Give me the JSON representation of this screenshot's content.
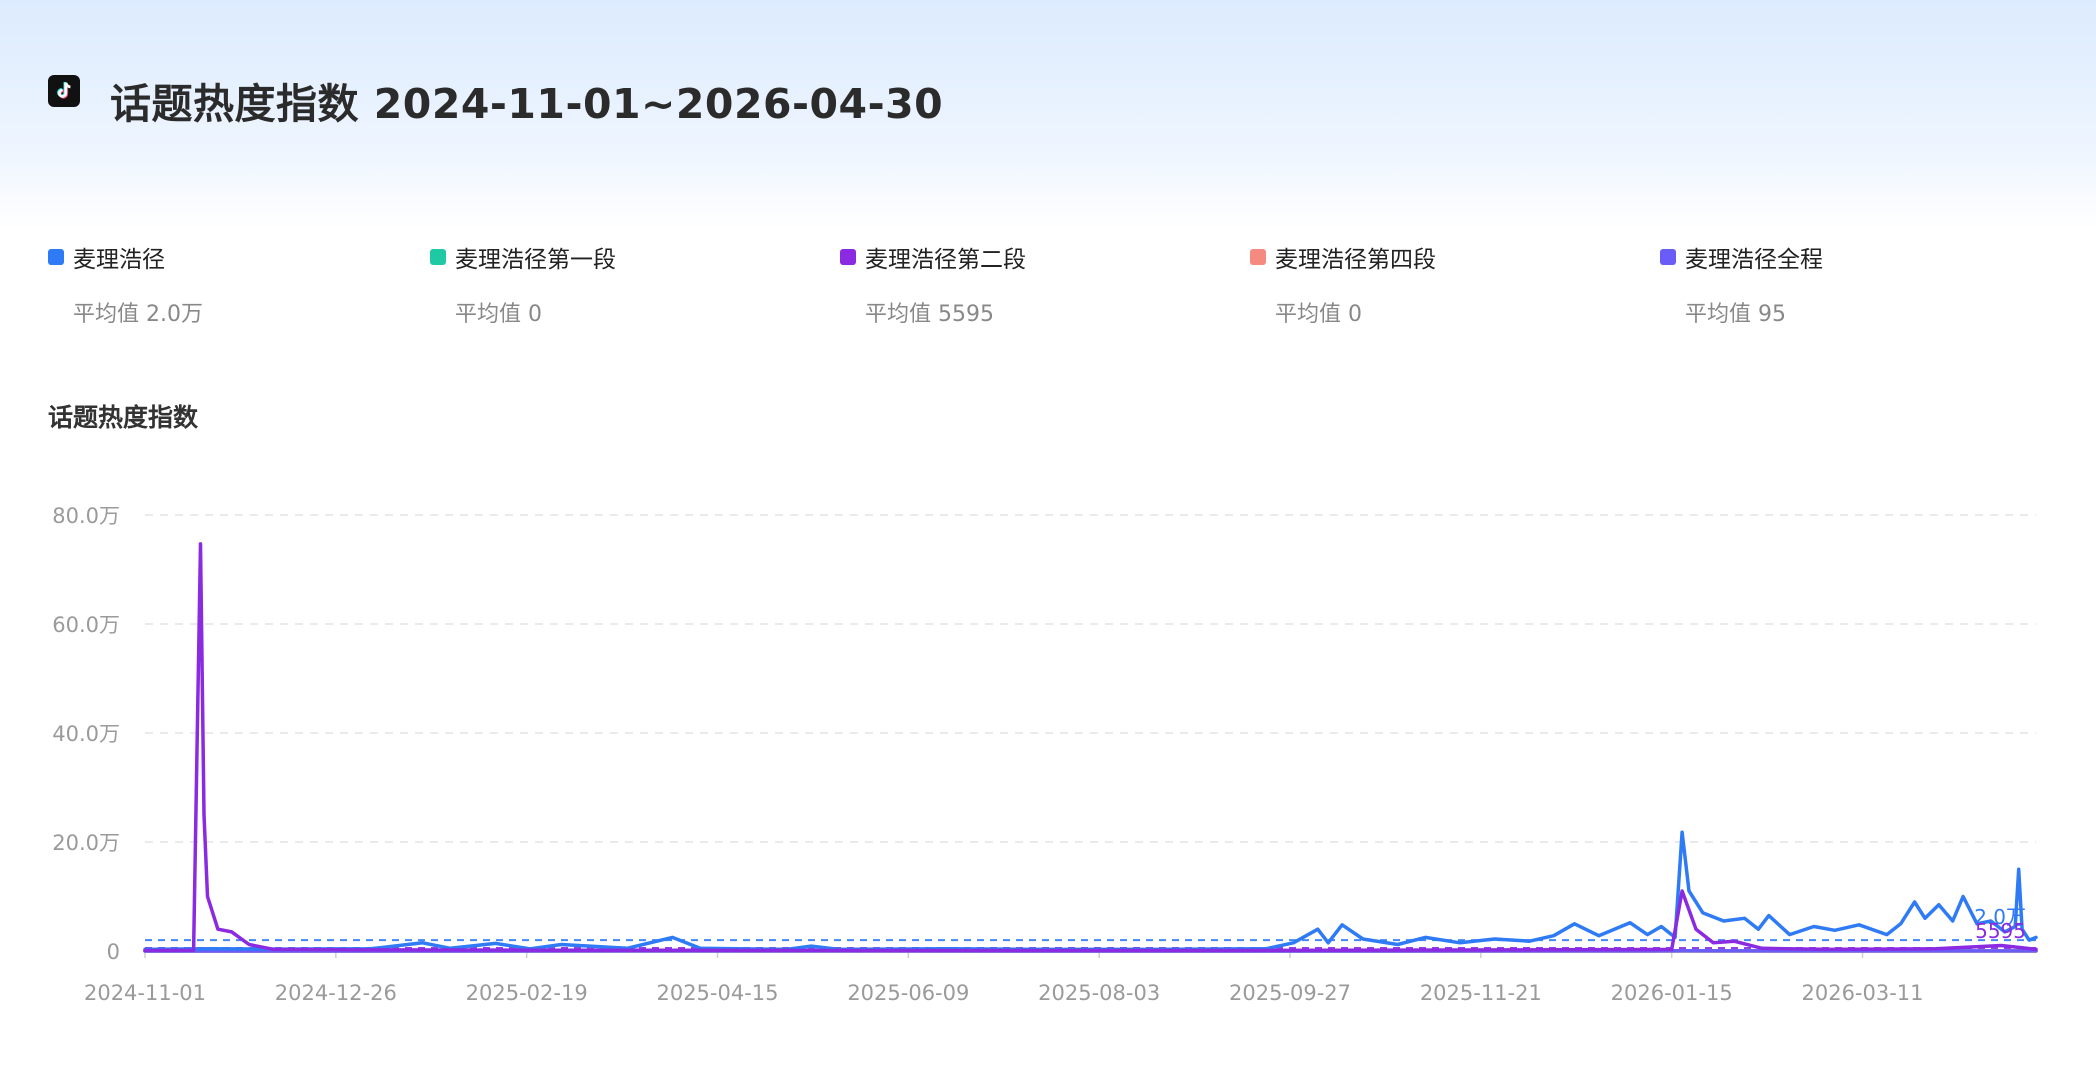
{
  "header": {
    "title": "话题热度指数 2024-11-01~2026-04-30",
    "logo_icon": "tiktok-logo-icon"
  },
  "legend": [
    {
      "name": "麦理浩径",
      "avg_label": "平均值 2.0万",
      "color": "#2f7bf5"
    },
    {
      "name": "麦理浩径第一段",
      "avg_label": "平均值 0",
      "color": "#1fc9a3"
    },
    {
      "name": "麦理浩径第二段",
      "avg_label": "平均值 5595",
      "color": "#8a2be2"
    },
    {
      "name": "麦理浩径第四段",
      "avg_label": "平均值 0",
      "color": "#f48a80"
    },
    {
      "name": "麦理浩径全程",
      "avg_label": "平均值 95",
      "color": "#6a5cf6"
    }
  ],
  "chart_title": "话题热度指数",
  "chart_data": {
    "type": "line",
    "ylim": [
      0,
      800000
    ],
    "y_ticks": [
      0,
      200000,
      400000,
      600000,
      800000
    ],
    "y_tick_labels": [
      "0",
      "20.0万",
      "40.0万",
      "60.0万",
      "80.0万"
    ],
    "x_tick_labels": [
      "2024-11-01",
      "2024-12-26",
      "2025-02-19",
      "2025-04-15",
      "2025-06-09",
      "2025-08-03",
      "2025-09-27",
      "2025-11-21",
      "2026-01-15",
      "2026-03-11"
    ],
    "x_range": [
      "2024-11-01",
      "2026-04-30"
    ],
    "grid": true,
    "avg_line_labels": [
      "2.0万",
      "5595"
    ],
    "series": [
      {
        "name": "麦理浩径",
        "color": "#2f7bf5",
        "average": 20000,
        "points": [
          [
            "2024-11-01",
            3000
          ],
          [
            "2024-11-20",
            4000
          ],
          [
            "2024-12-10",
            3500
          ],
          [
            "2025-01-05",
            4000
          ],
          [
            "2025-01-20",
            15000
          ],
          [
            "2025-01-28",
            5000
          ],
          [
            "2025-02-10",
            14000
          ],
          [
            "2025-02-20",
            4000
          ],
          [
            "2025-03-01",
            12000
          ],
          [
            "2025-03-20",
            5000
          ],
          [
            "2025-04-02",
            25000
          ],
          [
            "2025-04-10",
            5000
          ],
          [
            "2025-05-05",
            3000
          ],
          [
            "2025-05-12",
            9000
          ],
          [
            "2025-05-20",
            3000
          ],
          [
            "2025-06-20",
            4000
          ],
          [
            "2025-07-20",
            3000
          ],
          [
            "2025-08-20",
            3000
          ],
          [
            "2025-09-20",
            4000
          ],
          [
            "2025-09-28",
            15000
          ],
          [
            "2025-10-05",
            40000
          ],
          [
            "2025-10-08",
            15000
          ],
          [
            "2025-10-12",
            48000
          ],
          [
            "2025-10-18",
            22000
          ],
          [
            "2025-10-28",
            12000
          ],
          [
            "2025-11-05",
            25000
          ],
          [
            "2025-11-15",
            15000
          ],
          [
            "2025-11-25",
            22000
          ],
          [
            "2025-12-05",
            18000
          ],
          [
            "2025-12-12",
            28000
          ],
          [
            "2025-12-18",
            50000
          ],
          [
            "2025-12-25",
            28000
          ],
          [
            "2026-01-03",
            52000
          ],
          [
            "2026-01-08",
            30000
          ],
          [
            "2026-01-12",
            45000
          ],
          [
            "2026-01-16",
            25000
          ],
          [
            "2026-01-18",
            218000
          ],
          [
            "2026-01-20",
            110000
          ],
          [
            "2026-01-24",
            70000
          ],
          [
            "2026-01-30",
            55000
          ],
          [
            "2026-02-05",
            60000
          ],
          [
            "2026-02-09",
            40000
          ],
          [
            "2026-02-12",
            65000
          ],
          [
            "2026-02-18",
            30000
          ],
          [
            "2026-02-25",
            45000
          ],
          [
            "2026-03-03",
            38000
          ],
          [
            "2026-03-10",
            48000
          ],
          [
            "2026-03-18",
            30000
          ],
          [
            "2026-03-22",
            50000
          ],
          [
            "2026-03-26",
            90000
          ],
          [
            "2026-03-29",
            60000
          ],
          [
            "2026-04-02",
            85000
          ],
          [
            "2026-04-06",
            55000
          ],
          [
            "2026-04-09",
            100000
          ],
          [
            "2026-04-13",
            50000
          ],
          [
            "2026-04-17",
            55000
          ],
          [
            "2026-04-21",
            35000
          ],
          [
            "2026-04-24",
            45000
          ],
          [
            "2026-04-25",
            150000
          ],
          [
            "2026-04-26",
            40000
          ],
          [
            "2026-04-28",
            20000
          ],
          [
            "2026-04-30",
            25000
          ]
        ]
      },
      {
        "name": "麦理浩径第一段",
        "color": "#1fc9a3",
        "average": 0,
        "points": [
          [
            "2024-11-01",
            0
          ],
          [
            "2026-04-30",
            0
          ]
        ]
      },
      {
        "name": "麦理浩径第二段",
        "color": "#8a2be2",
        "average": 5595,
        "points": [
          [
            "2024-11-01",
            1000
          ],
          [
            "2024-11-15",
            1500
          ],
          [
            "2024-11-17",
            747000
          ],
          [
            "2024-11-18",
            250000
          ],
          [
            "2024-11-19",
            100000
          ],
          [
            "2024-11-22",
            40000
          ],
          [
            "2024-11-26",
            35000
          ],
          [
            "2024-12-01",
            12000
          ],
          [
            "2024-12-08",
            3000
          ],
          [
            "2025-01-01",
            2000
          ],
          [
            "2025-03-01",
            1500
          ],
          [
            "2025-06-01",
            1000
          ],
          [
            "2025-09-01",
            1000
          ],
          [
            "2025-12-01",
            2000
          ],
          [
            "2026-01-15",
            3000
          ],
          [
            "2026-01-18",
            110000
          ],
          [
            "2026-01-22",
            40000
          ],
          [
            "2026-01-27",
            15000
          ],
          [
            "2026-02-02",
            18000
          ],
          [
            "2026-02-10",
            5000
          ],
          [
            "2026-03-01",
            3000
          ],
          [
            "2026-04-01",
            4000
          ],
          [
            "2026-04-20",
            10000
          ],
          [
            "2026-04-26",
            6000
          ],
          [
            "2026-04-30",
            3000
          ]
        ]
      },
      {
        "name": "麦理浩径第四段",
        "color": "#f48a80",
        "average": 0,
        "points": [
          [
            "2024-11-01",
            0
          ],
          [
            "2026-04-30",
            0
          ]
        ]
      },
      {
        "name": "麦理浩径全程",
        "color": "#6a5cf6",
        "average": 95,
        "points": [
          [
            "2024-11-01",
            50
          ],
          [
            "2025-05-01",
            120
          ],
          [
            "2025-10-01",
            80
          ],
          [
            "2026-01-18",
            400
          ],
          [
            "2026-04-30",
            100
          ]
        ]
      }
    ]
  }
}
